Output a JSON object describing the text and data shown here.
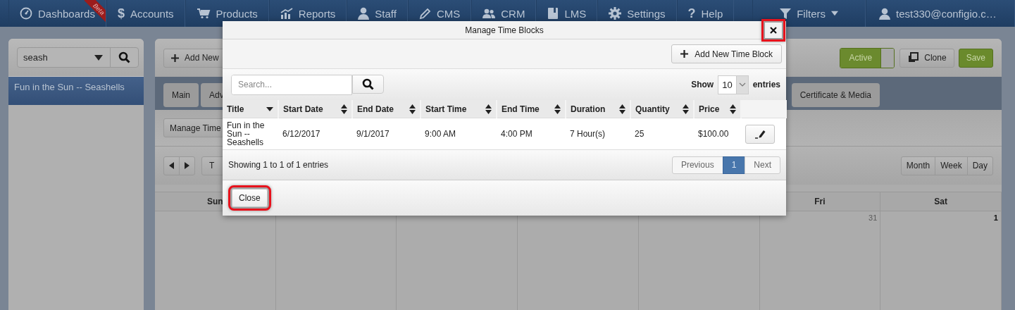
{
  "nav": {
    "items": [
      {
        "label": "Dashboards",
        "badge": "Beta"
      },
      {
        "label": "Accounts",
        "glyph": "$"
      },
      {
        "label": "Products"
      },
      {
        "label": "Reports"
      },
      {
        "label": "Staff"
      },
      {
        "label": "CMS"
      },
      {
        "label": "CRM"
      },
      {
        "label": "LMS"
      },
      {
        "label": "Settings"
      },
      {
        "label": "Help",
        "glyph": "?"
      }
    ],
    "filters": "Filters",
    "user": "test330@configio.c…"
  },
  "sidebar": {
    "search": {
      "value": "seash"
    },
    "items": [
      {
        "label": "Fun in the Sun -- Seashells",
        "selected": true
      }
    ]
  },
  "toolbar": {
    "add_button": "Add New",
    "status": {
      "label": "Active",
      "on": true
    },
    "clone_button": "Clone",
    "save_button": "Save"
  },
  "tabs": [
    {
      "label": "Main",
      "selected": false
    },
    {
      "label": "Adv",
      "selected": false
    },
    {
      "label": "Certificate & Media",
      "selected": false
    }
  ],
  "manage_button": "Manage Time",
  "calendar": {
    "today_button": "T",
    "views": [
      {
        "label": "Month",
        "selected": false
      },
      {
        "label": "Week",
        "selected": false
      },
      {
        "label": "Day",
        "selected": false
      }
    ],
    "days": [
      {
        "name": "Sun"
      },
      {
        "name": "Fri",
        "date": "31",
        "current_month": false
      },
      {
        "name": "Sat",
        "date": "1",
        "current_month": true
      }
    ]
  },
  "dialog": {
    "title": "Manage Time Blocks",
    "close_highlighted": true,
    "add_button": "Add New Time Block",
    "search": {
      "placeholder": "Search..."
    },
    "length": {
      "label": "Show",
      "value": "10",
      "suffix": "entries"
    },
    "table": {
      "columns": [
        {
          "label": "Title"
        },
        {
          "label": "Start Date"
        },
        {
          "label": "End Date"
        },
        {
          "label": "Start Time"
        },
        {
          "label": "End Time"
        },
        {
          "label": "Duration"
        },
        {
          "label": "Quantity"
        },
        {
          "label": "Price"
        }
      ],
      "rows": [
        [
          "Fun in the Sun -- Seashells",
          "6/12/2017",
          "9/1/2017",
          "9:00 AM",
          "4:00 PM",
          "7 Hour(s)",
          "25",
          "$100.00"
        ]
      ]
    },
    "info": "Showing 1 to 1 of 1 entries",
    "pagination": [
      {
        "label": "Previous",
        "selected": false
      },
      {
        "label": "1",
        "selected": true
      },
      {
        "label": "Next",
        "selected": false
      }
    ],
    "close_button": {
      "label": "Close",
      "highlighted": true
    }
  }
}
